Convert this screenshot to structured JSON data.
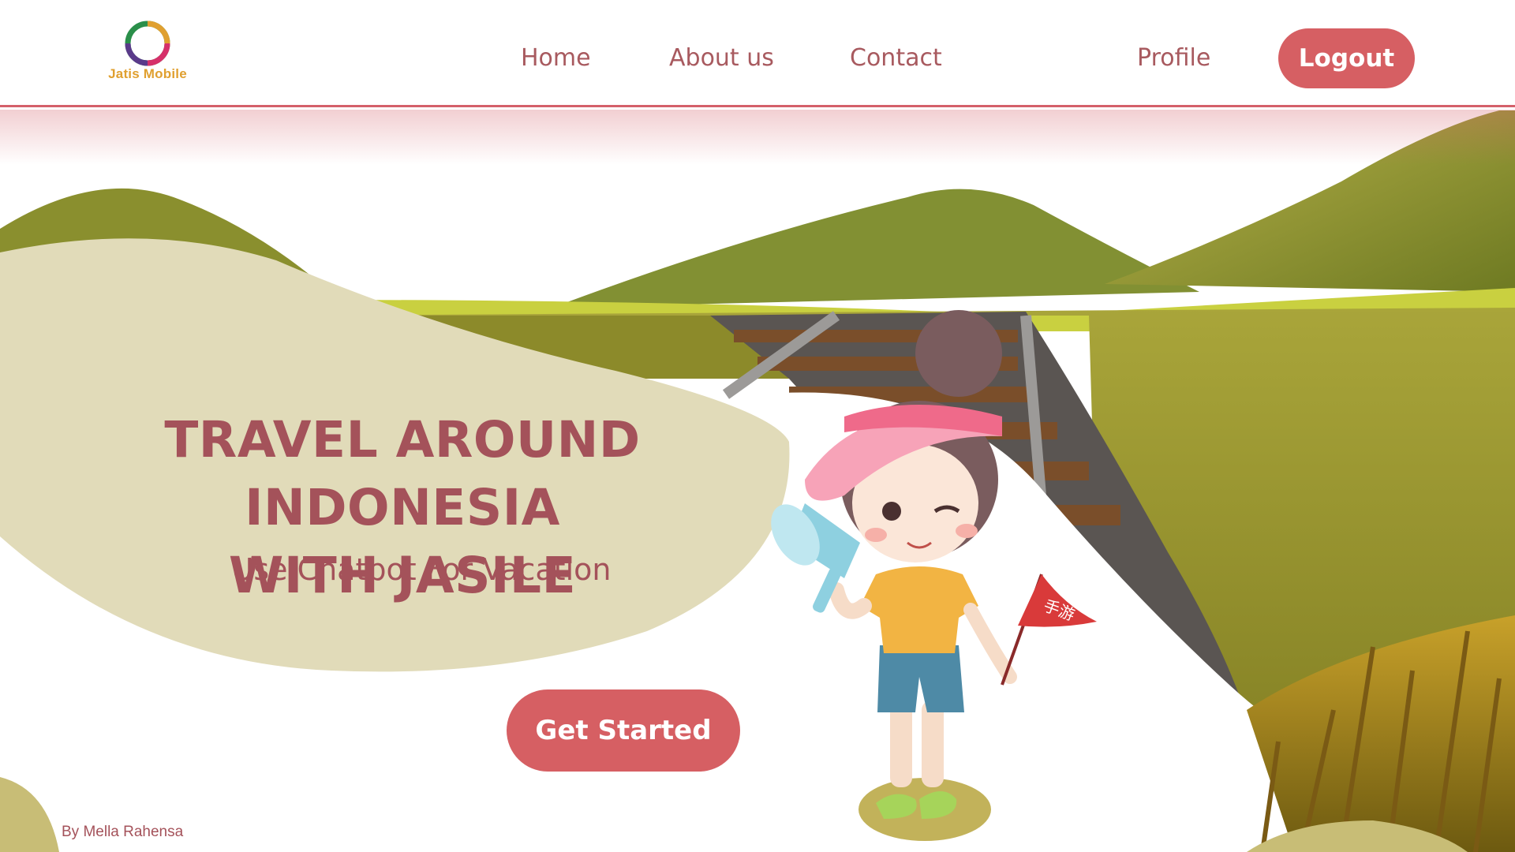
{
  "brand": {
    "name": "Jatis Mobile"
  },
  "nav": {
    "home": "Home",
    "about": "About us",
    "contact": "Contact",
    "profile": "Profile",
    "logout": "Logout"
  },
  "hero": {
    "title_line1": "TRAVEL AROUND INDONESIA",
    "title_line2": "WITH JASILE",
    "subtitle": "Use Chatbot For Vacation",
    "cta": "Get Started",
    "flag_text": "手游"
  },
  "footer": {
    "credit": "By Mella Rahensa"
  },
  "colors": {
    "accent": "#d65f63",
    "text": "#a4525a",
    "blob": "#e1dbb9",
    "hill": "#8a8f2e"
  },
  "icons": [
    "logo-ring-icon",
    "megaphone-icon",
    "flag-icon"
  ]
}
